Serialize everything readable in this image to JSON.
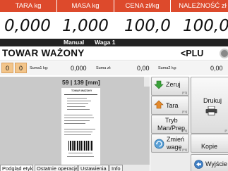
{
  "header": {
    "cols": [
      "TARA kg",
      "MASA kg",
      "CENA zł/kg",
      "NALEŻNOŚĆ zł"
    ]
  },
  "values": {
    "tara": "0,000",
    "masa": "1,000",
    "cena": "100,0",
    "naleznosc": "100,00"
  },
  "status": {
    "mode": "Manual",
    "scale": "Waga 1"
  },
  "product": {
    "name": "TOWAR WAŻONY",
    "plu": "<PLU"
  },
  "sums": {
    "box1": "0",
    "box2": "0",
    "suma1_label": "Suma1 kg:",
    "suma1_value": "0,000",
    "suma_zl_label": "Suma zł:",
    "suma_zl_value": "0,00",
    "suma2_label": "Suma2 kg:",
    "suma2_value": "0,00"
  },
  "preview": {
    "dimensions": "59 | 139 [mm]",
    "ticket_title": "TOWAR WAŻONY"
  },
  "tabs": [
    "Podgląd etykiety",
    "Ostatnie operacje",
    "Ustawienia",
    "Info"
  ],
  "buttons": {
    "zeruj": "Zeruj",
    "zeruj_key": "[F3]",
    "tara": "Tara",
    "tara_key": "[F4]",
    "tryb_line1": "Tryb",
    "tryb_line2": "Man/Prep",
    "tryb_key": "[F5]",
    "zmien_line1": "Zmień",
    "zmien_line2": "wagę",
    "zmien_key": "[F6]",
    "drukuj": "Drukuj",
    "kopie": "Kopie",
    "side_key": "[F",
    "wyjscie": "Wyjście"
  },
  "colors": {
    "header_bg": "#dd4a2c",
    "status_bg": "#222222",
    "preview_bg": "#c9c9c9",
    "accent_box": "#f3c58a"
  }
}
